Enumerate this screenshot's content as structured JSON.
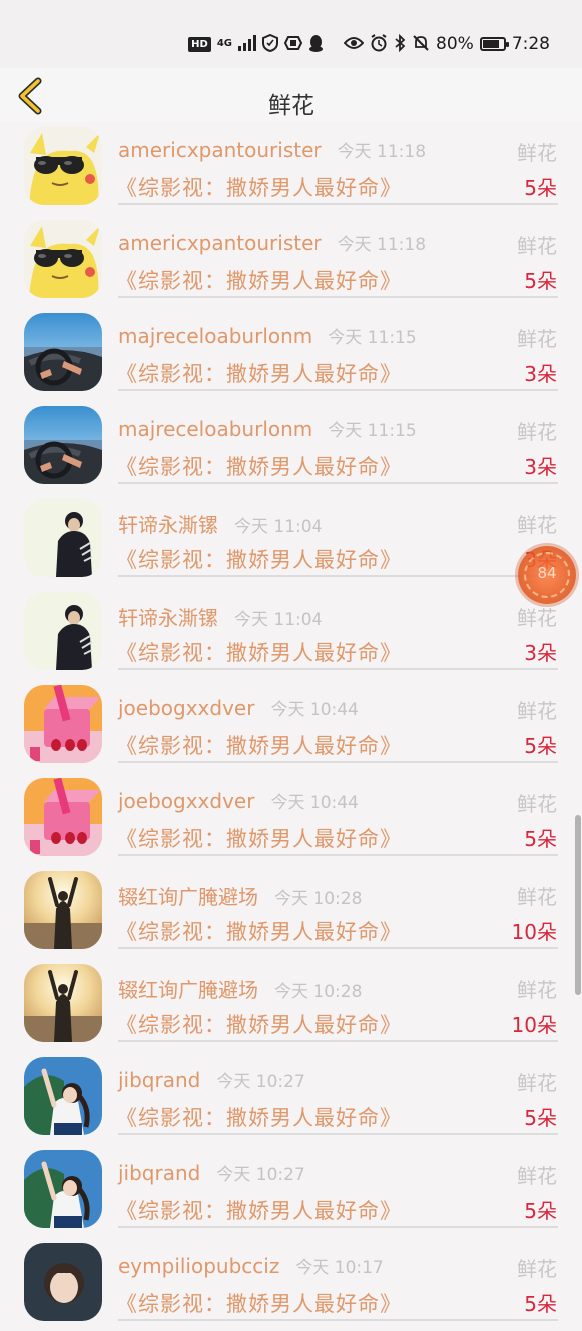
{
  "status_bar": {
    "hd": "HD",
    "network": "4G",
    "battery_percent": "80%",
    "battery_level": 0.8,
    "time": "7:28",
    "icons": [
      "signal-icon",
      "shield-icon",
      "hand-icon",
      "penguin-icon",
      "eye-icon",
      "alarm-icon",
      "bluetooth-icon",
      "mute-icon",
      "battery-icon"
    ]
  },
  "header": {
    "title": "鲜花",
    "back_icon": "chevron-left-icon"
  },
  "float_button": {
    "label": "84"
  },
  "list": [
    {
      "name": "americxpantourister",
      "time": "今天 11:18",
      "gift": "鲜花",
      "work": "《综影视：撒娇男人最好命》",
      "count": "5朵",
      "avatar": "pikachu"
    },
    {
      "name": "americxpantourister",
      "time": "今天 11:18",
      "gift": "鲜花",
      "work": "《综影视：撒娇男人最好命》",
      "count": "5朵",
      "avatar": "pikachu"
    },
    {
      "name": "majreceloaburlonm",
      "time": "今天 11:15",
      "gift": "鲜花",
      "work": "《综影视：撒娇男人最好命》",
      "count": "3朵",
      "avatar": "car"
    },
    {
      "name": "majreceloaburlonm",
      "time": "今天 11:15",
      "gift": "鲜花",
      "work": "《综影视：撒娇男人最好命》",
      "count": "3朵",
      "avatar": "car"
    },
    {
      "name": "轩谛永澌镙",
      "time": "今天 11:04",
      "gift": "鲜花",
      "work": "《综影视：撒娇男人最好命》",
      "count": "3朵",
      "avatar": "boy"
    },
    {
      "name": "轩谛永澌镙",
      "time": "今天 11:04",
      "gift": "鲜花",
      "work": "《综影视：撒娇男人最好命》",
      "count": "3朵",
      "avatar": "boy"
    },
    {
      "name": "joebogxxdver",
      "time": "今天 10:44",
      "gift": "鲜花",
      "work": "《综影视：撒娇男人最好命》",
      "count": "5朵",
      "avatar": "pink"
    },
    {
      "name": "joebogxxdver",
      "time": "今天 10:44",
      "gift": "鲜花",
      "work": "《综影视：撒娇男人最好命》",
      "count": "5朵",
      "avatar": "pink"
    },
    {
      "name": "辍红询广腌避场",
      "time": "今天 10:28",
      "gift": "鲜花",
      "work": "《综影视：撒娇男人最好命》",
      "count": "10朵",
      "avatar": "sunset"
    },
    {
      "name": "辍红询广腌避场",
      "time": "今天 10:28",
      "gift": "鲜花",
      "work": "《综影视：撒娇男人最好命》",
      "count": "10朵",
      "avatar": "sunset"
    },
    {
      "name": "jibqrand",
      "time": "今天 10:27",
      "gift": "鲜花",
      "work": "《综影视：撒娇男人最好命》",
      "count": "5朵",
      "avatar": "girl"
    },
    {
      "name": "jibqrand",
      "time": "今天 10:27",
      "gift": "鲜花",
      "work": "《综影视：撒娇男人最好命》",
      "count": "5朵",
      "avatar": "girl"
    },
    {
      "name": "eympiliopubcciz",
      "time": "今天 10:17",
      "gift": "鲜花",
      "work": "《综影视：撒娇男人最好命》",
      "count": "5朵",
      "avatar": "girl2"
    }
  ]
}
